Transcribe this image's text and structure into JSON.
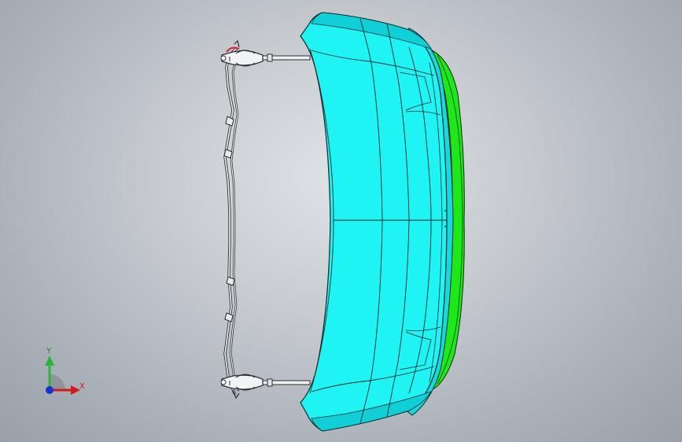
{
  "viewport": {
    "background_top": "#dfe2e6",
    "background_bottom": "#98a0a9"
  },
  "model": {
    "part_face_color": "#1ff3f3",
    "part_side_color": "#17d9dd",
    "lip_color": "#1ee81a",
    "edge_color": "#0b2a2a",
    "frame_color": "#eef0f2",
    "frame_edge_color": "#2a2f33",
    "clip_accent_color": "#d42424"
  },
  "triad": {
    "labels": {
      "x": "X",
      "y": "Y",
      "z": ""
    },
    "colors": {
      "x": "#d11b1b",
      "y": "#2bb53a",
      "z": "#1b2fd1"
    }
  }
}
